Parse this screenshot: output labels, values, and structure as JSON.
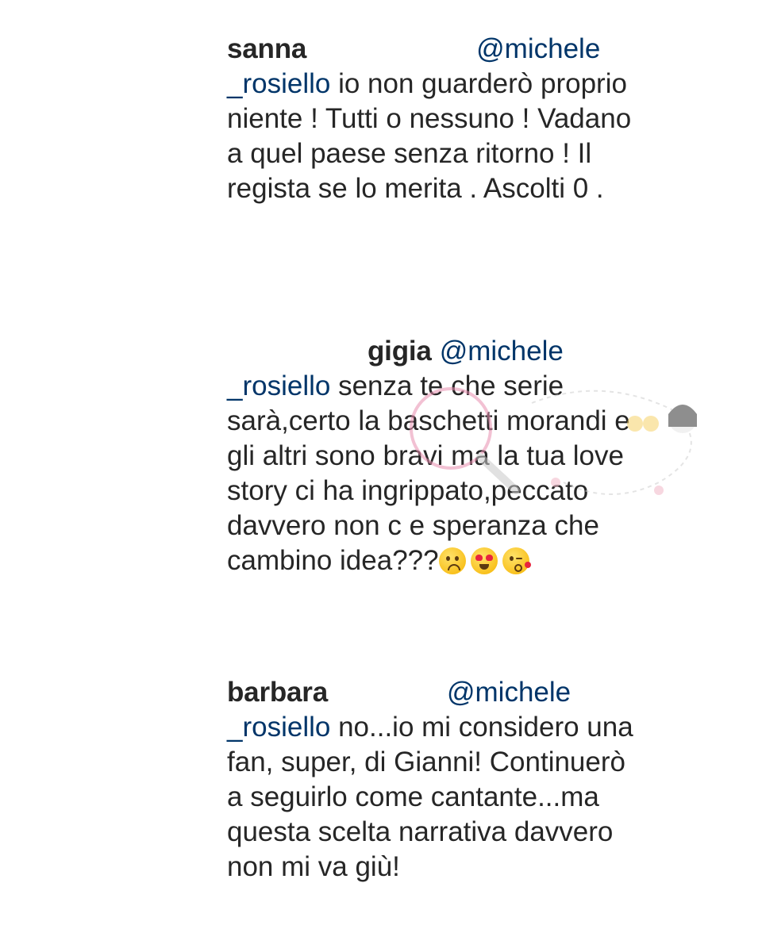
{
  "comments": [
    {
      "username": "sanna",
      "mention_start": "@michele",
      "mention_end": "_rosiello",
      "text_first": " io non guarderò proprio",
      "text_rest": "niente ! Tutti o nessuno ! Vadano\na quel paese senza ritorno ! Il\nregista se lo merita . Ascolti 0 ."
    },
    {
      "username": "gigia",
      "mention_start": "@michele",
      "mention_end": "_rosiello",
      "text_first": " senza te che serie",
      "text_rest": "sarà,certo la baschetti morandi e\ngli altri sono bravi ma la tua love\nstory ci ha ingrippato,peccato\ndavvero non c e speranza che",
      "text_last": "cambino idea???",
      "emojis": [
        "worried-face-icon",
        "heart-eyes-face-icon",
        "kissing-heart-face-icon"
      ]
    },
    {
      "username": "barbara",
      "mention_start": "@michele",
      "mention_end": "_rosiello",
      "text_first": " no...io mi considero una",
      "text_rest": "fan, super, di Gianni! Continuerò\na seguirlo come cantante...ma\nquesta scelta narrativa davvero\nnon mi va giù!"
    }
  ],
  "colors": {
    "text": "#262626",
    "mention": "#003569",
    "background": "#ffffff"
  }
}
